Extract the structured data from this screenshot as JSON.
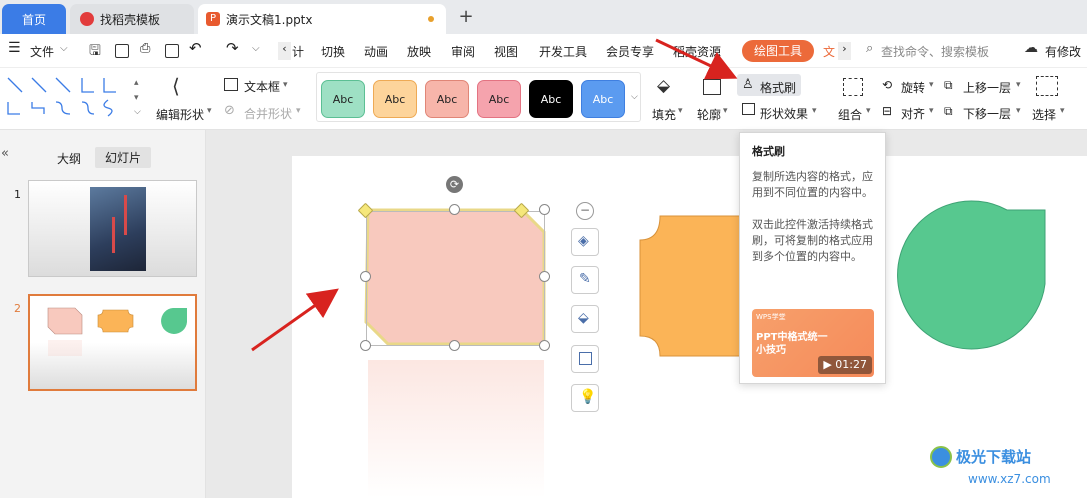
{
  "tabs": {
    "home": "首页",
    "template": "找稻壳模板",
    "document": "演示文稿1.pptx"
  },
  "menu": {
    "file": "文件",
    "items": [
      "计",
      "切换",
      "动画",
      "放映",
      "审阅",
      "视图",
      "开发工具",
      "会员专享",
      "稻壳资源"
    ],
    "draw_tool": "绘图工具",
    "next": "文",
    "search_placeholder": "查找命令、搜索模板",
    "has_changes": "有修改"
  },
  "ribbon": {
    "edit_shape": "编辑形状",
    "text_box": "文本框",
    "merge_shape": "合并形状",
    "style_label": "Abc",
    "fill": "填充",
    "outline": "轮廓",
    "format_brush": "格式刷",
    "shape_effect": "形状效果",
    "group": "组合",
    "rotate": "旋转",
    "align": "对齐",
    "move_up": "上移一层",
    "move_down": "下移一层",
    "select": "选择"
  },
  "style_colors": [
    {
      "bg": "#9ee0c4",
      "border": "#5cbf94",
      "text": "#333"
    },
    {
      "bg": "#fdd49b",
      "border": "#eeaa55",
      "text": "#333"
    },
    {
      "bg": "#f7b5aa",
      "border": "#e08677",
      "text": "#333"
    },
    {
      "bg": "#f5a3ad",
      "border": "#e37382",
      "text": "#333"
    },
    {
      "bg": "#000000",
      "border": "#000000",
      "text": "#ffffff"
    },
    {
      "bg": "#5b9bf0",
      "border": "#3f7fe0",
      "text": "#ffffff"
    }
  ],
  "panel": {
    "outline_tab": "大纲",
    "slides_tab": "幻灯片",
    "slide1_num": "1",
    "slide2_num": "2"
  },
  "tooltip": {
    "title": "格式刷",
    "desc1": "复制所选内容的格式，应用到不同位置的内容中。",
    "desc2": "双击此控件激活持续格式刷，可将复制的格式应用到多个位置的内容中。",
    "video_title": "PPT中格式统一小技巧",
    "video_tag": "WPS学堂",
    "duration": "01:27"
  },
  "watermark": {
    "site": "极光下载站",
    "url": "www.xz7.com"
  },
  "colors": {
    "accent": "#3b7ce6",
    "draw_tool": "#ec6a3a",
    "selected_slide": "#e07b3c",
    "shape_pink": "#f8c9be",
    "shape_orange": "#fbb457",
    "shape_green": "#57c88f"
  }
}
